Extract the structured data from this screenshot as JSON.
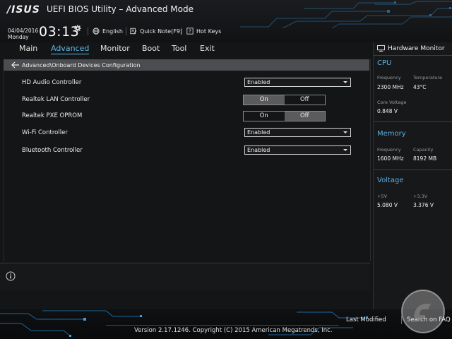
{
  "header": {
    "logo_text": "/ISUS",
    "title": "UEFI BIOS Utility – Advanced Mode",
    "date": "04/04/2016",
    "day": "Monday",
    "time": "03:13",
    "language": "English",
    "quick_note": "Quick Note(F9)",
    "hot_keys": "Hot Keys"
  },
  "menu": {
    "items": [
      {
        "label": "Main"
      },
      {
        "label": "Advanced"
      },
      {
        "label": "Monitor"
      },
      {
        "label": "Boot"
      },
      {
        "label": "Tool"
      },
      {
        "label": "Exit"
      }
    ],
    "active": "Advanced"
  },
  "breadcrumb": "Advanced\\Onboard Devices Configuration",
  "settings": [
    {
      "label": "HD Audio Controller",
      "type": "dropdown",
      "value": "Enabled"
    },
    {
      "label": "Realtek LAN Controller",
      "type": "toggle",
      "on_label": "On",
      "off_label": "Off",
      "value": "On"
    },
    {
      "label": "Realtek PXE OPROM",
      "type": "toggle",
      "on_label": "On",
      "off_label": "Off",
      "value": "Off"
    },
    {
      "label": "Wi-Fi Controller",
      "type": "dropdown",
      "value": "Enabled"
    },
    {
      "label": "Bluetooth Controller",
      "type": "dropdown",
      "value": "Enabled"
    }
  ],
  "hardware_monitor": {
    "title": "Hardware Monitor",
    "cpu": {
      "heading": "CPU",
      "frequency_label": "Frequency",
      "frequency": "2300 MHz",
      "temperature_label": "Temperature",
      "temperature": "43°C",
      "core_voltage_label": "Core Voltage",
      "core_voltage": "0.848 V"
    },
    "memory": {
      "heading": "Memory",
      "frequency_label": "Frequency",
      "frequency": "1600 MHz",
      "capacity_label": "Capacity",
      "capacity": "8192 MB"
    },
    "voltage": {
      "heading": "Voltage",
      "v5_label": "+5V",
      "v5": "5.080 V",
      "v33_label": "+3.3V",
      "v33": "3.376 V"
    }
  },
  "footer": {
    "last_modified": "Last Modified",
    "search_faq": "Search on FAQ",
    "version": "Version 2.17.1246. Copyright (C) 2015 American Megatrends, Inc."
  },
  "colors": {
    "accent": "#5fb8e8",
    "breadcrumb_bar": "#4c4d50",
    "background": "#141517",
    "toggle_selected": "#5b5b5d"
  },
  "icons": [
    "gear-icon",
    "globe-icon",
    "quick-note-icon",
    "hot-keys-icon",
    "back-arrow-icon",
    "info-icon",
    "monitor-icon"
  ]
}
